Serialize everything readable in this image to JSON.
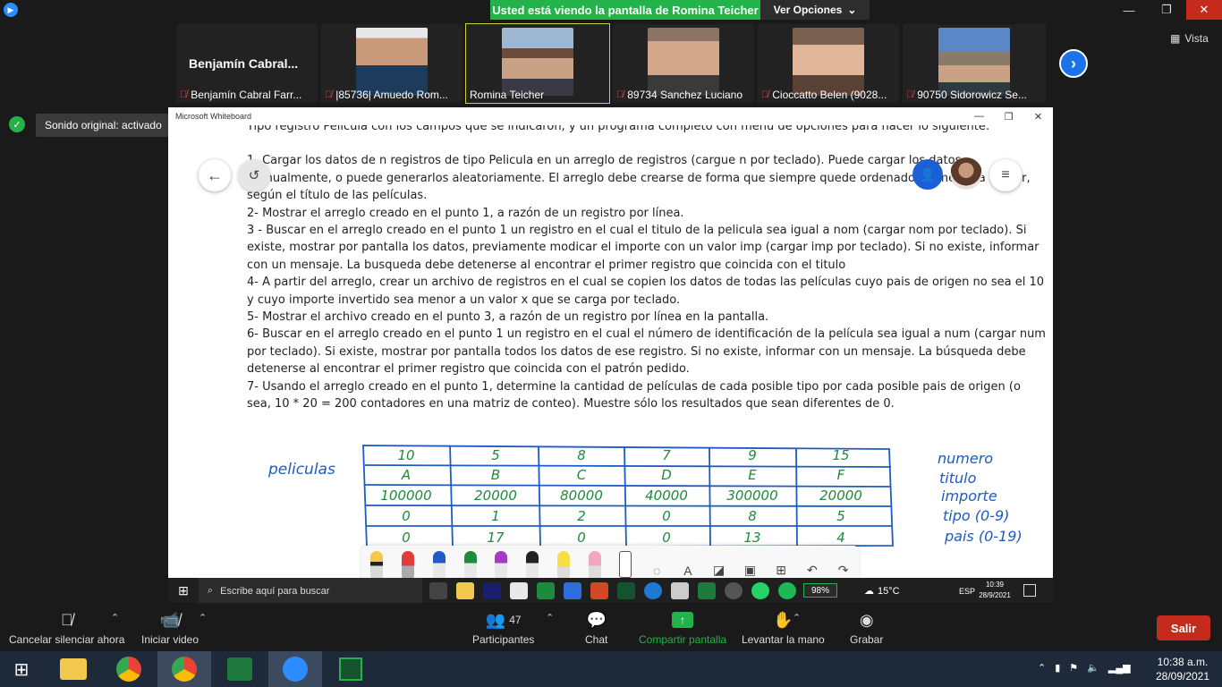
{
  "topbar": {
    "share_banner": "Usted está viendo la pantalla de Romina Teicher",
    "view_options": "Ver Opciones"
  },
  "participants": {
    "big_name": "Benjamín  Cabral...",
    "tiles": [
      {
        "name": "Benjamín Cabral Farr..."
      },
      {
        "name": "|85736| Amuedo Rom..."
      },
      {
        "name": "Romina Teicher"
      },
      {
        "name": "89734 Sanchez Luciano"
      },
      {
        "name": "Cioccatto Belen (9028..."
      },
      {
        "name": "90750 Sidorowicz Se..."
      }
    ],
    "vista": "Vista"
  },
  "sound_toast": "Sonido original: activado",
  "whiteboard": {
    "window_title": "Microsoft Whiteboard",
    "lines": [
      "Tipo registro Pelicula con los campos que se indicaron, y un programa completo con menu de opciones para hacer lo siguiente:",
      "",
      "1- Cargar los datos de n registros de tipo Pelicula en un arreglo de registros (cargue n por teclado). Puede cargar los datos manualmente, o puede generarlos aleatoriamente. El arreglo debe crearse de forma que siempre quede ordenado de menor a mayor, según el título de las películas.",
      "2- Mostrar el arreglo creado en el punto 1, a razón de un registro por línea.",
      "3 - Buscar en el arreglo creado en el punto 1 un registro en el cual el titulo de la pelicula sea igual a nom (cargar nom por teclado). Si existe, mostrar por pantalla los datos, previamente modicar el importe con un valor imp (cargar imp por teclado). Si no existe, informar con un mensaje. La busqueda debe detenerse al encontrar el primer registro que coincida con el titulo",
      "4- A partir del arreglo, crear un archivo de registros en el cual se copien los datos de todas las películas cuyo pais de origen no sea el 10 y cuyo importe invertido sea menor a un valor x que se carga por teclado.",
      "5- Mostrar el archivo creado en el punto 3, a razón de un registro por línea en la pantalla.",
      "6- Buscar en el arreglo creado en el punto 1 un registro en el cual el número de identificación de la película sea igual a num (cargar num por teclado). Si existe, mostrar por pantalla todos los datos de ese registro. Si no existe, informar con un mensaje. La búsqueda debe detenerse al encontrar el primer registro que coincida con el patrón pedido.",
      "7- Usando el arreglo creado en el punto 1, determine la cantidad de películas de cada posible tipo por cada posible pais de origen (o sea, 10 * 20 = 200 contadores en una matriz de conteo). Muestre sólo los resultados que sean diferentes de 0."
    ],
    "handwriting": {
      "left_label": "peliculas",
      "right_labels": [
        "numero",
        "titulo",
        "importe",
        "tipo (0-9)",
        "pais (0-19)"
      ],
      "table": [
        [
          "10",
          "5",
          "8",
          "7",
          "9",
          "15"
        ],
        [
          "A",
          "B",
          "C",
          "D",
          "E",
          "F"
        ],
        [
          "100000",
          "20000",
          "80000",
          "40000",
          "300000",
          "20000"
        ],
        [
          "0",
          "1",
          "2",
          "0",
          "8",
          "5"
        ],
        [
          "0",
          "17",
          "0",
          "0",
          "13",
          "4"
        ]
      ]
    }
  },
  "inner_taskbar": {
    "search_placeholder": "Escribe aquí para buscar",
    "battery": "98%",
    "weather": "15°C",
    "lang": "ESP",
    "time": "10:39",
    "date": "28/9/2021"
  },
  "zoom_controls": {
    "mute": "Cancelar silenciar ahora",
    "video": "Iniciar video",
    "participants_count": "47",
    "participants": "Participantes",
    "chat": "Chat",
    "share": "Compartir pantalla",
    "raise_hand": "Levantar la mano",
    "record": "Grabar",
    "leave": "Salir"
  },
  "outer_taskbar": {
    "time": "10:38 a.m.",
    "date": "28/09/2021"
  },
  "colors": {
    "share_green": "#23b34a",
    "leave_red": "#c42b1c",
    "ink_blue": "#1f5bc4",
    "ink_green": "#1e8a3c"
  }
}
